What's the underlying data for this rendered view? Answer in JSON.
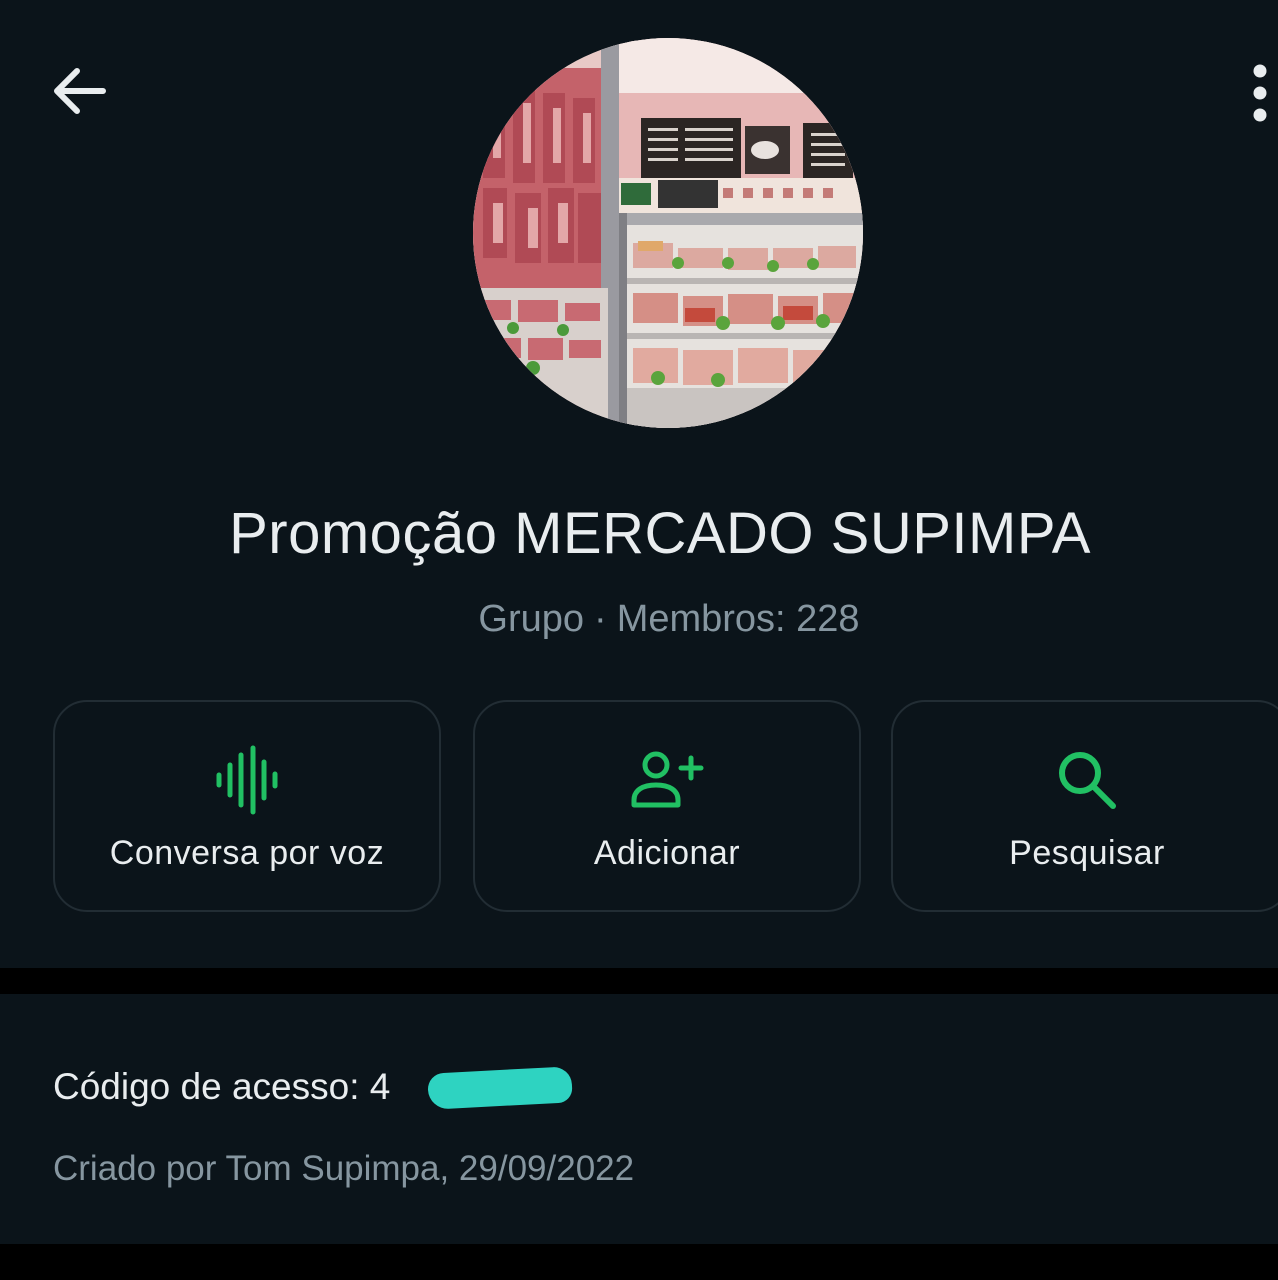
{
  "header": {
    "back_icon": "arrow-left-icon",
    "menu_icon": "more-vertical-icon"
  },
  "group": {
    "name": "Promoção MERCADO SUPIMPA",
    "type_label": "Grupo",
    "separator": "·",
    "members_label": "Membros: 228",
    "avatar_description_icon": "group-avatar-photo"
  },
  "actions": [
    {
      "label": "Conversa por voz",
      "icon": "voice-waveform-icon"
    },
    {
      "label": "Adicionar",
      "icon": "add-person-icon"
    },
    {
      "label": "Pesquisar",
      "icon": "search-icon"
    }
  ],
  "info": {
    "access_code_label": "Código de acesso: 4",
    "created_by": "Criado por Tom Supimpa, 29/09/2022"
  },
  "colors": {
    "background": "#0b141a",
    "accent_green": "#21c063",
    "text_primary": "#e9edef",
    "text_secondary": "#8696a0",
    "card_border": "#222d34",
    "redaction": "#2ed3c1"
  }
}
